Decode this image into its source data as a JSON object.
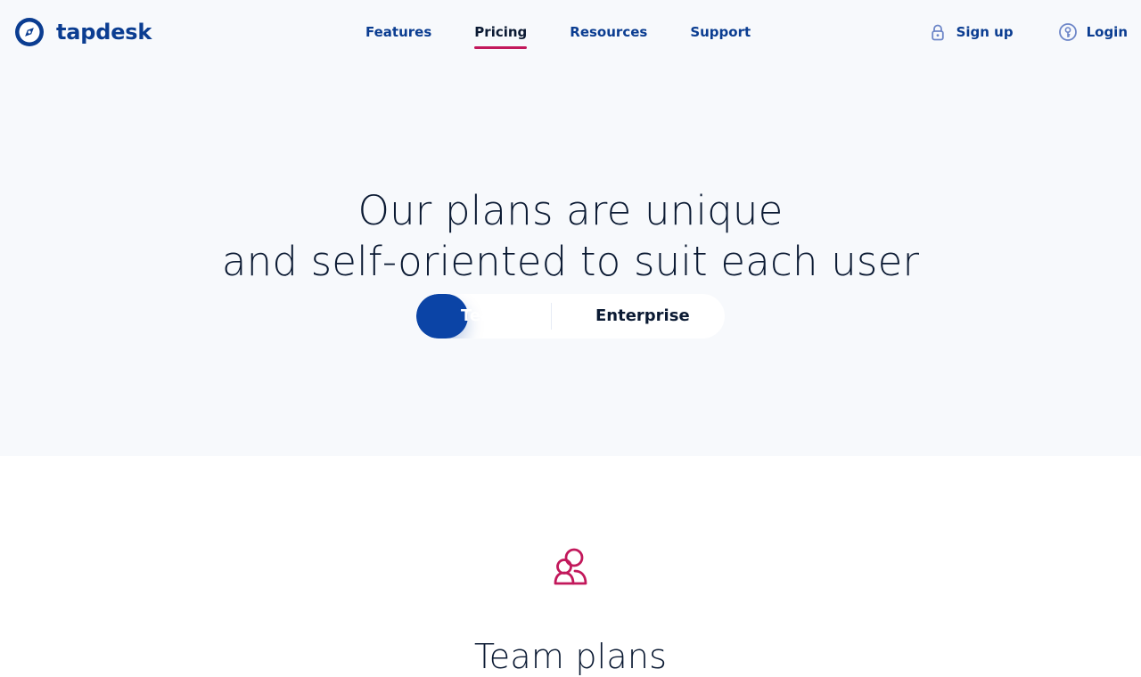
{
  "brand": {
    "name": "tapdesk",
    "color": "#0b3d91",
    "logo_icon": "compass-icon"
  },
  "nav": {
    "items": [
      {
        "label": "Features",
        "active": false
      },
      {
        "label": "Pricing",
        "active": true
      },
      {
        "label": "Resources",
        "active": false
      },
      {
        "label": "Support",
        "active": false
      }
    ],
    "active_underline_color": "#c2185b"
  },
  "auth": {
    "signup_label": "Sign up",
    "signup_icon": "lock-icon",
    "login_label": "Login",
    "login_icon": "key-icon"
  },
  "hero": {
    "headline_line1": "Our plans are unique",
    "headline_line2": "and self-oriented to suit each user",
    "background": "#f7f9fc"
  },
  "plan_toggle": {
    "options": [
      {
        "label": "Team",
        "selected": true
      },
      {
        "label": "Enterprise",
        "selected": false
      }
    ],
    "selected_color": "#0b44a6"
  },
  "section": {
    "icon": "team-icon",
    "icon_color": "#c2185b",
    "title": "Team plans"
  }
}
